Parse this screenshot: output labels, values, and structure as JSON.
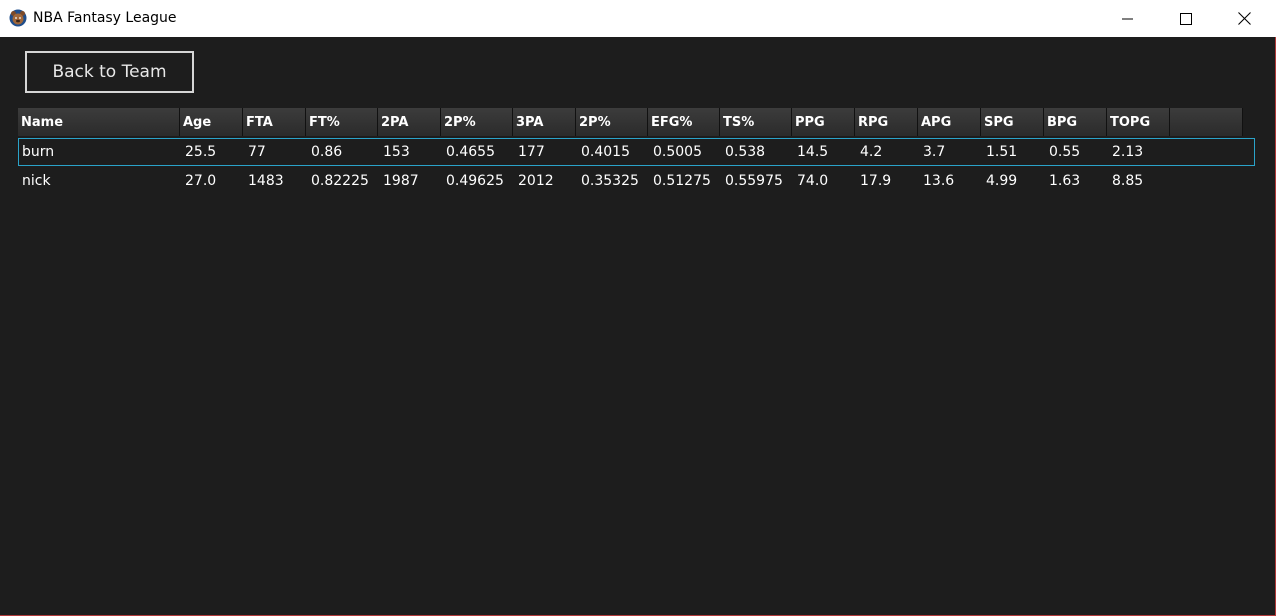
{
  "window": {
    "title": "NBA Fantasy League",
    "icon": "bear-logo-icon",
    "controls": [
      "minimize-icon",
      "maximize-icon",
      "close-icon"
    ]
  },
  "back_button": {
    "label": "Back to Team"
  },
  "table": {
    "columns": [
      "Name",
      "Age",
      "FTA",
      "FT%",
      "2PA",
      "2P%",
      "3PA",
      "2P%",
      "EFG%",
      "TS%",
      "PPG",
      "RPG",
      "APG",
      "SPG",
      "BPG",
      "TOPG",
      ""
    ],
    "rows": [
      [
        "burn",
        "25.5",
        "77",
        "0.86",
        "153",
        "0.4655",
        "177",
        "0.4015",
        "0.5005",
        "0.538",
        "14.5",
        "4.2",
        "3.7",
        "1.51",
        "0.55",
        "2.13"
      ],
      [
        "nick",
        "27.0",
        "1483",
        "0.82225",
        "1987",
        "0.49625",
        "2012",
        "0.35325",
        "0.51275",
        "0.55975",
        "74.0",
        "17.9",
        "13.6",
        "4.99",
        "1.63",
        "8.85"
      ]
    ],
    "selected_row": 0
  },
  "colors": {
    "background": "#1d1d1d",
    "selection_border": "#2aa3c9",
    "window_border": "#b03a3a"
  }
}
